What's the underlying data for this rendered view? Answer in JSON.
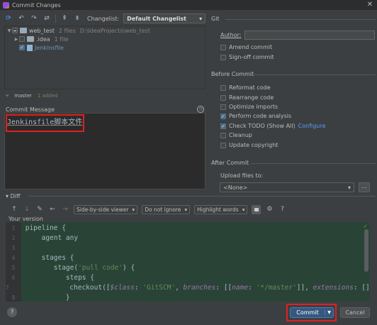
{
  "window": {
    "title": "Commit Changes"
  },
  "toolbar": {
    "changelist_label": "Changelist:",
    "changelist_value": "Default Changelist"
  },
  "tree": {
    "root": {
      "name": "web_test",
      "count": "2 files",
      "path": "D:\\IdeaProjects\\web_test"
    },
    "child_folder": {
      "name": ".idea",
      "count": "1 file"
    },
    "child_file": {
      "name": "Jenkinsfile"
    }
  },
  "status": {
    "branch": "master",
    "added": "1 added"
  },
  "message": {
    "label": "Commit Message",
    "text": "Jenkinsfile脚本文件"
  },
  "git": {
    "section": "Git",
    "author_label": "Author:",
    "author_value": "",
    "amend": "Amend commit",
    "signoff": "Sign-off commit"
  },
  "before_commit": {
    "section": "Before Commit",
    "reformat": "Reformat code",
    "rearrange": "Rearrange code",
    "optimize": "Optimize imports",
    "analysis": "Perform code analysis",
    "todo": "Check TODO (Show All)",
    "todo_link": "Configure",
    "cleanup": "Cleanup",
    "copyright": "Update copyright"
  },
  "after_commit": {
    "section": "After Commit",
    "upload_label": "Upload files to:",
    "upload_value": "<None>",
    "upload_btn": "..."
  },
  "diff": {
    "label": "Diff",
    "viewer": "Side-by-side viewer",
    "ignore": "Do not ignore",
    "highlight": "Highlight words",
    "help": "?",
    "version_label": "Your version",
    "line_numbers": [
      "1",
      "2",
      "3",
      "4",
      "5",
      "6",
      "7",
      "8"
    ]
  },
  "footer": {
    "help": "?",
    "commit": "Commit",
    "cancel": "Cancel"
  },
  "colors": {
    "background": "#3c3f41",
    "editor_added": "#294436",
    "accent": "#365880",
    "highlight_box": "#e02020"
  }
}
